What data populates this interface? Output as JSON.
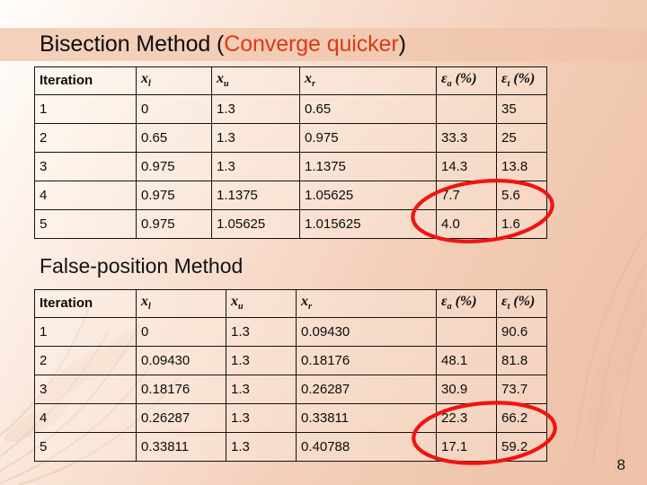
{
  "slide": {
    "title_main": "Bisection Method (",
    "title_accent": "Converge quicker",
    "title_close": ")",
    "section_heading": "False-position Method",
    "page_number": "8",
    "accent_color": "#d93b17",
    "annotation_color": "#ee1511",
    "background_start": "#fffdfb",
    "background_end": "#eec1a8"
  },
  "columns": {
    "iteration": "Iteration",
    "xl": "x",
    "xl_sub": "l",
    "xu": "x",
    "xu_sub": "u",
    "xr": "x",
    "xr_sub": "r",
    "ea": "ε",
    "ea_sub": "a",
    "ea_unit": " (%)",
    "et": "ε",
    "et_sub": "t",
    "et_unit": " (%)"
  },
  "bisection_table": {
    "name": "Bisection Method",
    "rows": [
      {
        "iteration": "1",
        "xl": "0",
        "xu": "1.3",
        "xr": "0.65",
        "ea": "",
        "et": "35"
      },
      {
        "iteration": "2",
        "xl": "0.65",
        "xu": "1.3",
        "xr": "0.975",
        "ea": "33.3",
        "et": "25"
      },
      {
        "iteration": "3",
        "xl": "0.975",
        "xu": "1.3",
        "xr": "1.1375",
        "ea": "14.3",
        "et": "13.8"
      },
      {
        "iteration": "4",
        "xl": "0.975",
        "xu": "1.1375",
        "xr": "1.05625",
        "ea": "7.7",
        "et": "5.6"
      },
      {
        "iteration": "5",
        "xl": "0.975",
        "xu": "1.05625",
        "xr": "1.015625",
        "ea": "4.0",
        "et": "1.6"
      }
    ]
  },
  "falseposition_table": {
    "name": "False-position Method",
    "rows": [
      {
        "iteration": "1",
        "xl": "0",
        "xu": "1.3",
        "xr": "0.09430",
        "ea": "",
        "et": "90.6"
      },
      {
        "iteration": "2",
        "xl": "0.09430",
        "xu": "1.3",
        "xr": "0.18176",
        "ea": "48.1",
        "et": "81.8"
      },
      {
        "iteration": "3",
        "xl": "0.18176",
        "xu": "1.3",
        "xr": "0.26287",
        "ea": "30.9",
        "et": "73.7"
      },
      {
        "iteration": "4",
        "xl": "0.26287",
        "xu": "1.3",
        "xr": "0.33811",
        "ea": "22.3",
        "et": "66.2"
      },
      {
        "iteration": "5",
        "xl": "0.33811",
        "xu": "1.3",
        "xr": "0.40788",
        "ea": "17.1",
        "et": "59.2"
      }
    ]
  },
  "annotations": [
    {
      "name": "bisection-last-rows-circle",
      "target": "bisection rows 4-5, error columns"
    },
    {
      "name": "falseposition-last-rows-circle",
      "target": "false-position rows 4-5, error columns"
    }
  ]
}
